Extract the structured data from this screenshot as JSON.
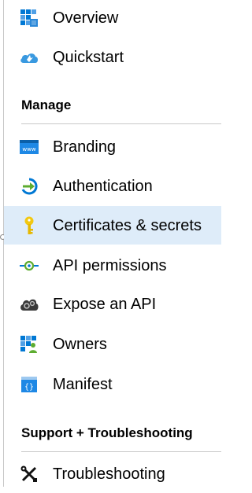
{
  "nav": {
    "items": [
      {
        "label": "Overview",
        "icon": "overview-grid-icon"
      },
      {
        "label": "Quickstart",
        "icon": "quickstart-cloud-icon"
      },
      {
        "label": "Branding",
        "icon": "branding-www-icon"
      },
      {
        "label": "Authentication",
        "icon": "authentication-arrow-icon"
      },
      {
        "label": "Certificates & secrets",
        "icon": "key-icon",
        "selected": true
      },
      {
        "label": "API permissions",
        "icon": "api-permissions-icon"
      },
      {
        "label": "Expose an API",
        "icon": "expose-api-cloud-gear-icon"
      },
      {
        "label": "Owners",
        "icon": "owners-grid-person-icon"
      },
      {
        "label": "Manifest",
        "icon": "manifest-braces-icon"
      },
      {
        "label": "Troubleshooting",
        "icon": "wrench-screwdriver-icon"
      }
    ]
  },
  "sections": {
    "manage": "Manage",
    "support": "Support + Troubleshooting"
  },
  "colors": {
    "selected_bg": "#deecf9",
    "azure_blue": "#0078d4",
    "green": "#5dac30",
    "key_yellow": "#f2c811"
  }
}
